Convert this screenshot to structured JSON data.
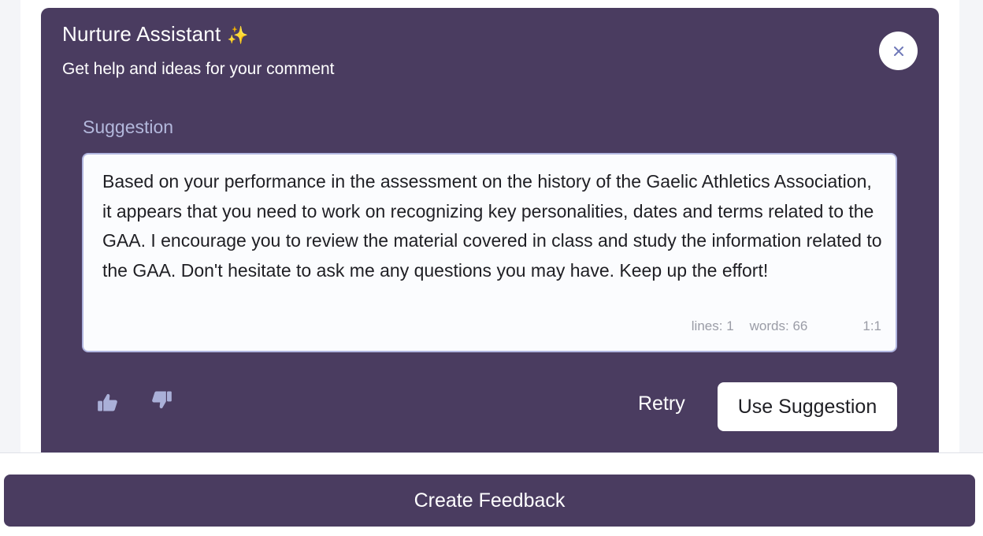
{
  "assistant": {
    "title": "Nurture Assistant",
    "sparkle": "✨",
    "subtitle": "Get help and ideas for your comment",
    "close_icon": "close-icon"
  },
  "suggestion": {
    "label": "Suggestion",
    "text": "Based on your performance in the assessment on the history of the Gaelic Athletics Association, it appears that you need to work on recognizing key personalities, dates and terms related to the GAA. I encourage you to review the material covered in class and study the information related to the GAA. Don't hesitate to ask me any questions you may have. Keep up the effort!",
    "status": {
      "lines": "lines: 1",
      "words": "words: 66",
      "cursor": "1:1"
    }
  },
  "actions": {
    "thumbs_up_icon": "thumbs-up-icon",
    "thumbs_down_icon": "thumbs-down-icon",
    "retry_label": "Retry",
    "use_suggestion_label": "Use Suggestion"
  },
  "footer": {
    "create_feedback_label": "Create Feedback"
  },
  "colors": {
    "panel": "#4a3c60",
    "suggestion_label": "#b3b8dc",
    "editor_border": "#b1b6e0",
    "icon": "#aab0d8"
  }
}
